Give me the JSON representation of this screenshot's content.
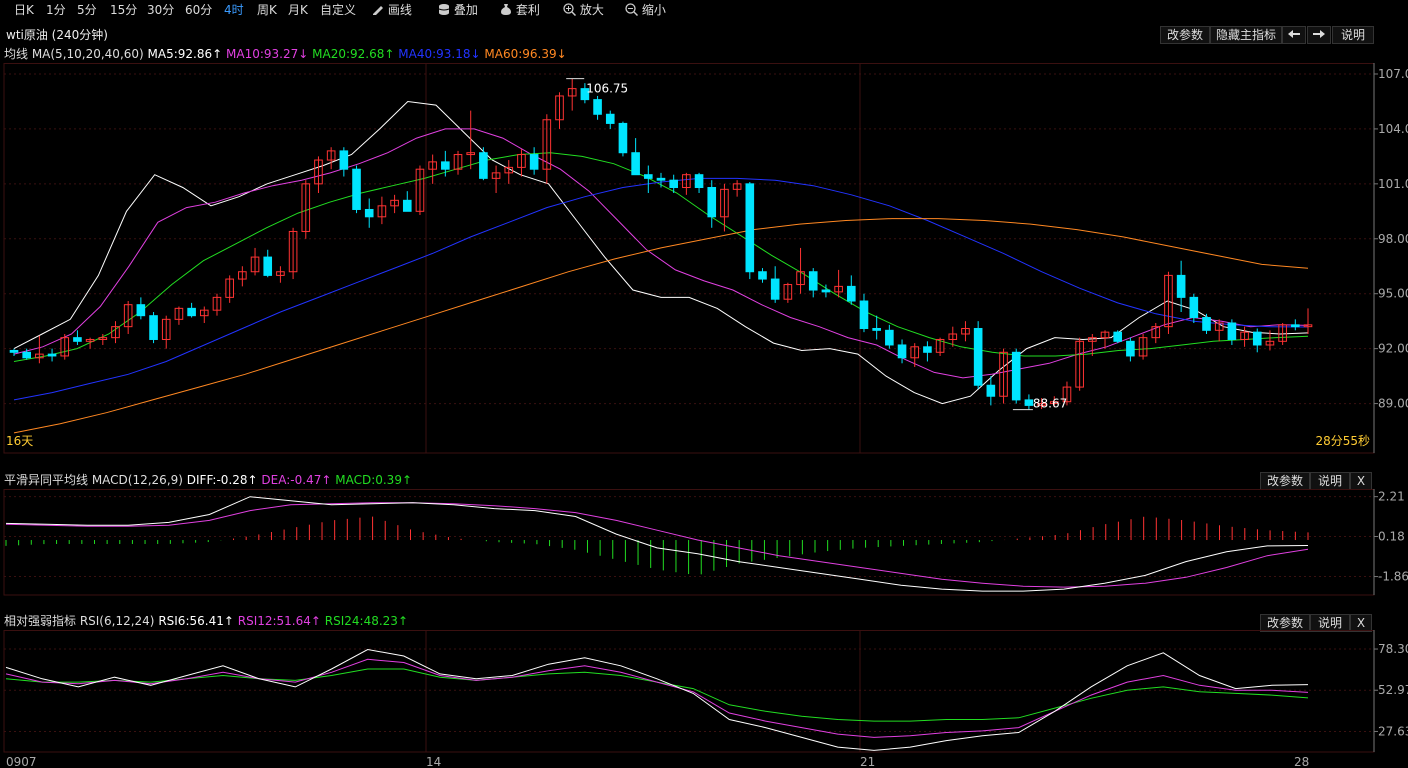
{
  "toolbar": {
    "items": [
      "日K",
      "1分",
      "5分",
      "15分",
      "30分",
      "60分",
      "4时",
      "周K",
      "月K",
      "自定义"
    ],
    "active_index": 6,
    "tools": [
      {
        "icon": "pencil-icon",
        "label": "画线"
      },
      {
        "icon": "database-icon",
        "label": "叠加"
      },
      {
        "icon": "money-bag-icon",
        "label": "套利"
      },
      {
        "icon": "zoom-in-icon",
        "label": "放大"
      },
      {
        "icon": "zoom-out-icon",
        "label": "缩小"
      }
    ]
  },
  "main_panel": {
    "title": "wti原油 (240分钟)",
    "buttons": [
      "改参数",
      "隐藏主指标",
      "←",
      "→",
      "说明"
    ],
    "ma": {
      "name": "均线 MA(5,10,20,40,60)",
      "values": [
        "MA5:92.86↑",
        "MA10:93.27↓",
        "MA20:92.68↑",
        "MA40:93.18↓",
        "MA60:96.39↓"
      ],
      "colors": [
        "#ffffff",
        "#e040e0",
        "#22dd22",
        "#2233ff",
        "#ff8822"
      ]
    },
    "price_labels": [
      "107.00",
      "104.00",
      "101.00",
      "98.00",
      "95.00",
      "92.00",
      "89.00"
    ],
    "high_marker": "106.75",
    "low_marker": "88.67",
    "left_note": "16天",
    "right_note": "28分55秒"
  },
  "macd_panel": {
    "name": "平滑异同平均线 MACD(12,26,9)",
    "values": [
      "DIFF:-0.28↑",
      "DEA:-0.47↑",
      "MACD:0.39↑"
    ],
    "colors": [
      "#ffffff",
      "#e040e0",
      "#22dd22"
    ],
    "buttons": [
      "改参数",
      "说明",
      "X"
    ],
    "axis_labels": [
      "2.21",
      "0.18",
      "-1.86"
    ]
  },
  "rsi_panel": {
    "name": "相对强弱指标 RSI(6,12,24)",
    "values": [
      "RSI6:56.41↑",
      "RSI12:51.64↑",
      "RSI24:48.23↑"
    ],
    "colors": [
      "#ffffff",
      "#e040e0",
      "#22dd22"
    ],
    "buttons": [
      "改参数",
      "说明",
      "X"
    ],
    "axis_labels": [
      "78.30",
      "52.97",
      "27.63"
    ]
  },
  "x_labels": [
    "0907",
    "14",
    "21",
    "28"
  ],
  "colors": {
    "up": "#ff3333",
    "down": "#00e5ff",
    "grid": "#3a1010",
    "axis": "#777"
  },
  "chart_data": {
    "type": "candlestick",
    "series_ohlc": [
      [
        91.9,
        92.0,
        91.6,
        91.8
      ],
      [
        91.8,
        92.0,
        91.4,
        91.5
      ],
      [
        91.5,
        92.7,
        91.2,
        91.7
      ],
      [
        91.7,
        92.0,
        91.3,
        91.6
      ],
      [
        91.6,
        92.8,
        91.4,
        92.6
      ],
      [
        92.6,
        93.0,
        92.2,
        92.4
      ],
      [
        92.4,
        92.6,
        92.0,
        92.5
      ],
      [
        92.5,
        92.8,
        92.2,
        92.6
      ],
      [
        92.6,
        93.5,
        92.3,
        93.2
      ],
      [
        93.2,
        94.6,
        92.8,
        94.4
      ],
      [
        94.4,
        94.8,
        93.6,
        93.8
      ],
      [
        93.8,
        94.0,
        92.3,
        92.5
      ],
      [
        92.5,
        93.8,
        92.0,
        93.6
      ],
      [
        93.6,
        94.3,
        93.3,
        94.2
      ],
      [
        94.2,
        94.5,
        93.7,
        93.8
      ],
      [
        93.8,
        94.3,
        93.4,
        94.1
      ],
      [
        94.1,
        95.0,
        93.8,
        94.8
      ],
      [
        94.8,
        96.0,
        94.5,
        95.8
      ],
      [
        95.8,
        96.5,
        95.4,
        96.2
      ],
      [
        96.2,
        97.5,
        96.0,
        97.0
      ],
      [
        97.0,
        97.4,
        95.9,
        96.0
      ],
      [
        96.0,
        96.5,
        95.6,
        96.2
      ],
      [
        96.2,
        98.6,
        95.8,
        98.4
      ],
      [
        98.4,
        101.2,
        98.0,
        101.0
      ],
      [
        101.0,
        102.5,
        100.5,
        102.3
      ],
      [
        102.3,
        103.0,
        101.8,
        102.8
      ],
      [
        102.8,
        103.0,
        101.4,
        101.8
      ],
      [
        101.8,
        102.0,
        99.4,
        99.6
      ],
      [
        99.6,
        100.2,
        98.6,
        99.2
      ],
      [
        99.2,
        100.3,
        98.8,
        99.8
      ],
      [
        99.8,
        100.4,
        99.4,
        100.1
      ],
      [
        100.1,
        100.6,
        99.6,
        99.5
      ],
      [
        99.5,
        102.0,
        99.3,
        101.8
      ],
      [
        101.8,
        102.6,
        101.0,
        102.2
      ],
      [
        102.2,
        102.8,
        101.4,
        101.8
      ],
      [
        101.8,
        102.8,
        101.5,
        102.6
      ],
      [
        102.6,
        105.0,
        101.8,
        102.7
      ],
      [
        102.7,
        103.0,
        101.2,
        101.3
      ],
      [
        101.3,
        102.0,
        100.5,
        101.6
      ],
      [
        101.6,
        102.3,
        101.0,
        101.9
      ],
      [
        101.9,
        102.9,
        101.4,
        102.6
      ],
      [
        102.6,
        103.0,
        101.5,
        101.8
      ],
      [
        101.8,
        104.8,
        101.0,
        104.5
      ],
      [
        104.5,
        106.0,
        104.0,
        105.8
      ],
      [
        105.8,
        106.75,
        105.0,
        106.2
      ],
      [
        106.2,
        106.5,
        105.4,
        105.6
      ],
      [
        105.6,
        105.8,
        104.5,
        104.8
      ],
      [
        104.8,
        105.0,
        104.0,
        104.3
      ],
      [
        104.3,
        104.4,
        102.5,
        102.7
      ],
      [
        102.7,
        103.5,
        101.6,
        101.5
      ],
      [
        101.5,
        102.0,
        100.5,
        101.3
      ],
      [
        101.3,
        101.6,
        100.8,
        101.2
      ],
      [
        101.2,
        101.5,
        100.5,
        100.8
      ],
      [
        100.8,
        101.6,
        100.4,
        101.5
      ],
      [
        101.5,
        101.6,
        100.5,
        100.8
      ],
      [
        100.8,
        101.2,
        98.6,
        99.2
      ],
      [
        99.2,
        101.0,
        98.4,
        100.7
      ],
      [
        100.7,
        101.2,
        100.3,
        101.0
      ],
      [
        101.0,
        101.1,
        95.8,
        96.2
      ],
      [
        96.2,
        96.4,
        95.6,
        95.8
      ],
      [
        95.8,
        96.5,
        94.5,
        94.7
      ],
      [
        94.7,
        95.6,
        94.5,
        95.5
      ],
      [
        95.5,
        97.5,
        95.0,
        96.2
      ],
      [
        96.2,
        96.4,
        94.8,
        95.2
      ],
      [
        95.2,
        95.5,
        94.8,
        95.1
      ],
      [
        95.1,
        96.3,
        94.8,
        95.4
      ],
      [
        95.4,
        96.0,
        94.4,
        94.6
      ],
      [
        94.6,
        95.0,
        92.9,
        93.1
      ],
      [
        93.1,
        93.8,
        92.5,
        93.0
      ],
      [
        93.0,
        93.3,
        92.0,
        92.2
      ],
      [
        92.2,
        92.5,
        91.2,
        91.5
      ],
      [
        91.5,
        92.3,
        91.0,
        92.1
      ],
      [
        92.1,
        92.4,
        91.3,
        91.8
      ],
      [
        91.8,
        92.6,
        91.6,
        92.5
      ],
      [
        92.5,
        93.2,
        92.1,
        92.8
      ],
      [
        92.8,
        93.5,
        92.4,
        93.1
      ],
      [
        93.1,
        93.5,
        89.8,
        90.0
      ],
      [
        90.0,
        90.5,
        88.9,
        89.4
      ],
      [
        89.4,
        92.0,
        89.0,
        91.8
      ],
      [
        91.8,
        92.0,
        89.0,
        89.2
      ],
      [
        89.2,
        89.5,
        88.67,
        88.9
      ],
      [
        88.9,
        89.3,
        88.7,
        89.0
      ],
      [
        89.0,
        89.4,
        88.8,
        89.1
      ],
      [
        89.1,
        90.2,
        88.9,
        89.9
      ],
      [
        89.9,
        92.6,
        89.7,
        92.4
      ],
      [
        92.4,
        92.8,
        91.6,
        92.6
      ],
      [
        92.6,
        93.0,
        92.0,
        92.9
      ],
      [
        92.9,
        93.0,
        92.3,
        92.4
      ],
      [
        92.4,
        92.6,
        91.3,
        91.6
      ],
      [
        91.6,
        92.8,
        91.4,
        92.6
      ],
      [
        92.6,
        93.4,
        92.3,
        93.2
      ],
      [
        93.2,
        96.2,
        92.8,
        96.0
      ],
      [
        96.0,
        96.8,
        94.0,
        94.8
      ],
      [
        94.8,
        95.0,
        93.4,
        93.7
      ],
      [
        93.7,
        93.9,
        92.8,
        93.0
      ],
      [
        93.0,
        93.6,
        92.4,
        93.4
      ],
      [
        93.4,
        93.6,
        92.2,
        92.5
      ],
      [
        92.5,
        93.2,
        92.1,
        92.9
      ],
      [
        92.9,
        93.1,
        91.8,
        92.2
      ],
      [
        92.2,
        93.0,
        91.9,
        92.4
      ],
      [
        92.4,
        93.4,
        92.2,
        93.3
      ],
      [
        93.3,
        93.6,
        93.0,
        93.2
      ],
      [
        93.2,
        94.2,
        92.8,
        93.3
      ]
    ],
    "ma_series": [
      {
        "name": "MA5",
        "values": [
          92.0,
          92.8,
          93.6,
          96.0,
          99.5,
          101.5,
          100.8,
          99.8,
          100.3,
          101.0,
          101.5,
          102.0,
          102.6,
          104.0,
          105.5,
          105.3,
          103.8,
          102.3,
          101.5,
          101.0,
          99.0,
          97.0,
          95.2,
          94.8,
          94.8,
          94.2,
          93.2,
          92.3,
          91.9,
          92.0,
          91.7,
          90.5,
          89.6,
          89.0,
          89.4,
          90.8,
          92.0,
          92.6,
          92.5,
          92.6,
          93.7,
          94.6,
          94.1,
          93.2,
          92.9,
          92.8,
          92.86
        ]
      },
      {
        "name": "MA10",
        "values": [
          91.7,
          92.1,
          92.8,
          94.3,
          96.5,
          98.9,
          99.7,
          100.0,
          100.5,
          100.9,
          101.2,
          101.6,
          102.1,
          102.7,
          103.5,
          104.0,
          104.0,
          103.5,
          102.6,
          101.8,
          100.6,
          99.0,
          97.4,
          96.3,
          95.7,
          95.2,
          94.4,
          93.7,
          93.2,
          92.6,
          92.2,
          91.4,
          90.7,
          90.4,
          90.6,
          90.9,
          91.2,
          91.7,
          92.1,
          92.7,
          93.3,
          93.7,
          93.5,
          93.2,
          93.3,
          93.27
        ]
      },
      {
        "name": "MA20",
        "values": [
          91.3,
          91.6,
          92.0,
          92.8,
          94.0,
          95.5,
          96.8,
          97.7,
          98.6,
          99.4,
          100.0,
          100.5,
          100.9,
          101.3,
          101.8,
          102.3,
          102.6,
          102.7,
          102.5,
          102.1,
          101.4,
          100.5,
          99.3,
          98.2,
          97.1,
          96.1,
          95.0,
          94.0,
          93.2,
          92.6,
          92.1,
          91.8,
          91.6,
          91.6,
          91.7,
          91.9,
          92.0,
          92.2,
          92.4,
          92.5,
          92.6,
          92.68
        ]
      },
      {
        "name": "MA40",
        "values": [
          89.2,
          89.6,
          90.1,
          90.6,
          91.3,
          92.2,
          93.1,
          94.0,
          94.8,
          95.6,
          96.4,
          97.2,
          98.1,
          98.9,
          99.7,
          100.3,
          100.8,
          101.1,
          101.3,
          101.3,
          101.2,
          100.9,
          100.4,
          99.8,
          99.0,
          98.1,
          97.2,
          96.2,
          95.3,
          94.5,
          93.9,
          93.5,
          93.3,
          93.2,
          93.18
        ]
      },
      {
        "name": "MA60",
        "values": [
          87.4,
          87.9,
          88.5,
          89.2,
          89.9,
          90.6,
          91.4,
          92.2,
          93.0,
          93.8,
          94.6,
          95.4,
          96.2,
          96.9,
          97.5,
          98.0,
          98.5,
          98.8,
          99.0,
          99.1,
          99.1,
          99.0,
          98.8,
          98.5,
          98.1,
          97.6,
          97.1,
          96.6,
          96.39
        ]
      }
    ],
    "macd": {
      "diff": [
        0.85,
        0.8,
        0.75,
        0.75,
        0.9,
        1.3,
        2.21,
        2.0,
        1.8,
        1.85,
        1.9,
        1.8,
        1.6,
        1.5,
        1.2,
        0.3,
        -0.4,
        -0.7,
        -1.1,
        -1.4,
        -1.7,
        -2.0,
        -2.3,
        -2.5,
        -2.6,
        -2.6,
        -2.5,
        -2.2,
        -1.8,
        -1.1,
        -0.6,
        -0.3,
        -0.28
      ],
      "dea": [
        0.8,
        0.75,
        0.7,
        0.7,
        0.75,
        1.0,
        1.5,
        1.8,
        1.85,
        1.9,
        1.9,
        1.85,
        1.75,
        1.6,
        1.4,
        1.0,
        0.5,
        0.0,
        -0.4,
        -0.8,
        -1.1,
        -1.4,
        -1.7,
        -2.0,
        -2.2,
        -2.35,
        -2.4,
        -2.35,
        -2.2,
        -1.9,
        -1.4,
        -0.8,
        -0.47
      ],
      "hist": [
        -0.3,
        -0.2,
        -0.2,
        -0.2,
        -0.2,
        -0.1,
        0.2,
        0.6,
        1.0,
        1.2,
        0.5,
        0.1,
        -0.1,
        -0.2,
        -0.5,
        -1.0,
        -1.5,
        -1.8,
        -1.2,
        -0.9,
        -0.6,
        -0.4,
        -0.3,
        -0.2,
        -0.1,
        0.1,
        0.3,
        0.8,
        1.2,
        1.0,
        0.7,
        0.5,
        0.39
      ],
      "ylim": [
        -2.8,
        2.6
      ]
    },
    "rsi": {
      "rsi6": [
        67,
        60,
        55,
        61,
        56,
        62,
        68,
        60,
        55,
        66,
        78,
        74,
        63,
        60,
        62,
        69,
        73,
        68,
        60,
        51,
        35,
        30,
        24,
        18,
        16,
        18,
        22,
        25,
        27,
        40,
        55,
        68,
        76,
        62,
        54,
        56,
        56.41
      ],
      "rsi12": [
        63,
        58,
        57,
        59,
        57,
        60,
        64,
        60,
        58,
        64,
        72,
        70,
        62,
        59,
        61,
        65,
        68,
        64,
        58,
        52,
        39,
        34,
        30,
        26,
        24,
        25,
        27,
        28,
        30,
        40,
        50,
        58,
        62,
        56,
        53,
        53,
        51.64
      ],
      "rsi24": [
        60,
        58,
        58,
        59,
        58,
        60,
        62,
        60,
        59,
        62,
        66,
        66,
        61,
        59,
        61,
        63,
        64,
        62,
        58,
        54,
        44,
        40,
        37,
        35,
        34,
        34,
        35,
        35,
        36,
        42,
        48,
        53,
        55,
        52,
        51,
        50,
        48.23
      ],
      "ylim": [
        15,
        90
      ]
    }
  }
}
